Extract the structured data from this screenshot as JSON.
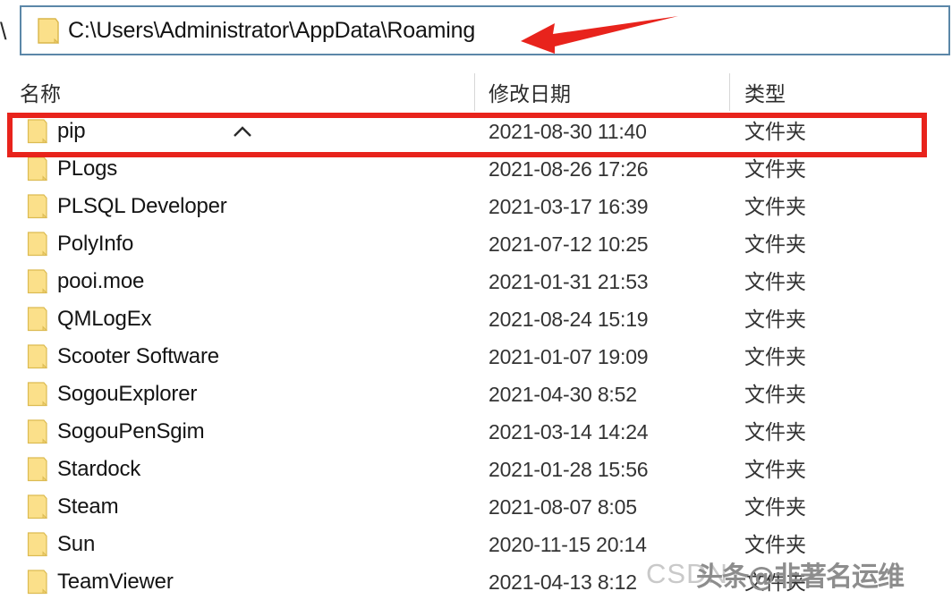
{
  "window": {
    "back_chevron": "\\"
  },
  "address_bar": {
    "icon": "folder-icon",
    "path": "C:\\Users\\Administrator\\AppData\\Roaming"
  },
  "annotation": {
    "arrow_color": "#e8231c",
    "arrow_direction": "left",
    "highlight_color": "#e8231c",
    "highlight_target_row": 0
  },
  "columns": {
    "name": "名称",
    "date_modified": "修改日期",
    "type": "类型",
    "sort_column": "名称",
    "sort_direction": "ascending",
    "sort_icon": "chevron-up-icon"
  },
  "files": [
    {
      "icon": "folder-icon",
      "name": "pip",
      "date": "2021-08-30 11:40",
      "type": "文件夹"
    },
    {
      "icon": "folder-icon",
      "name": "PLogs",
      "date": "2021-08-26 17:26",
      "type": "文件夹"
    },
    {
      "icon": "folder-icon",
      "name": "PLSQL Developer",
      "date": "2021-03-17 16:39",
      "type": "文件夹"
    },
    {
      "icon": "folder-icon",
      "name": "PolyInfo",
      "date": "2021-07-12 10:25",
      "type": "文件夹"
    },
    {
      "icon": "folder-icon",
      "name": "pooi.moe",
      "date": "2021-01-31 21:53",
      "type": "文件夹"
    },
    {
      "icon": "folder-icon",
      "name": "QMLogEx",
      "date": "2021-08-24 15:19",
      "type": "文件夹"
    },
    {
      "icon": "folder-icon",
      "name": "Scooter Software",
      "date": "2021-01-07 19:09",
      "type": "文件夹"
    },
    {
      "icon": "folder-icon",
      "name": "SogouExplorer",
      "date": "2021-04-30 8:52",
      "type": "文件夹"
    },
    {
      "icon": "folder-icon",
      "name": "SogouPenSgim",
      "date": "2021-03-14 14:24",
      "type": "文件夹"
    },
    {
      "icon": "folder-icon",
      "name": "Stardock",
      "date": "2021-01-28 15:56",
      "type": "文件夹"
    },
    {
      "icon": "folder-icon",
      "name": "Steam",
      "date": "2021-08-07 8:05",
      "type": "文件夹"
    },
    {
      "icon": "folder-icon",
      "name": "Sun",
      "date": "2020-11-15 20:14",
      "type": "文件夹"
    },
    {
      "icon": "folder-icon",
      "name": "TeamViewer",
      "date": "2021-04-13 8:12",
      "type": "文件夹"
    }
  ],
  "watermark": {
    "csdn": "CSDN",
    "toutiao": "头条@非著名运维"
  }
}
